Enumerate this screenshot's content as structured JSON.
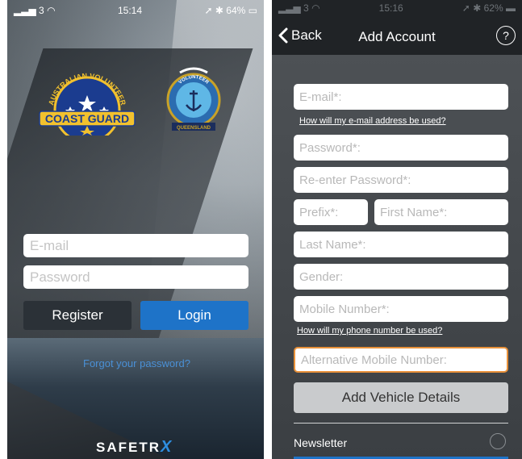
{
  "login_screen": {
    "status": {
      "carrier": "3",
      "time": "15:14",
      "battery": "64%"
    },
    "logos": {
      "coast_guard": {
        "arc_text": "AUSTRALIAN VOLUNTEER",
        "main_text": "COAST GUARD"
      },
      "vmr": {
        "top_text": "VOLUNTEER",
        "bottom_text": "QUEENSLAND"
      }
    },
    "email_placeholder": "E-mail",
    "password_placeholder": "Password",
    "register_label": "Register",
    "login_label": "Login",
    "forgot_password": "Forgot your password?",
    "brand": {
      "prefix": "SAFETR",
      "suffix": "X"
    },
    "colors": {
      "login_button": "#1e73c8",
      "register_button": "#2b3137",
      "link": "#4a90d6"
    }
  },
  "add_account_screen": {
    "status": {
      "carrier": "3",
      "time": "15:16",
      "battery": "62%"
    },
    "nav": {
      "back_label": "Back",
      "title": "Add Account",
      "help": "?"
    },
    "fields": {
      "email": "E-mail*:",
      "password": "Password*:",
      "reenter_password": "Re-enter Password*:",
      "prefix": "Prefix*:",
      "first_name": "First Name*:",
      "last_name": "Last Name*:",
      "gender": "Gender:",
      "mobile": "Mobile Number*:",
      "alt_mobile": "Alternative Mobile Number:"
    },
    "email_help": "How will my e-mail address be used?",
    "phone_help": "How will my phone number be used?",
    "vehicle_button": "Add Vehicle Details",
    "newsletter_label": "Newsletter",
    "colors": {
      "focus_border": "#e8913a",
      "accent": "#1e73c8"
    }
  }
}
